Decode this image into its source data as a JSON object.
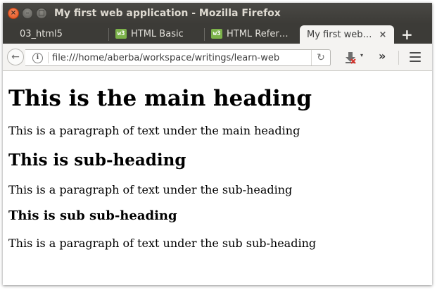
{
  "window": {
    "title": "My first web application - Mozilla Firefox",
    "close_glyph": "×",
    "minimize_glyph": "–",
    "maximize_glyph": "□"
  },
  "tabs": [
    {
      "label": "03_html5",
      "has_favicon": false,
      "active": false
    },
    {
      "label": "HTML Basic",
      "has_favicon": true,
      "active": false
    },
    {
      "label": "HTML Refer…",
      "has_favicon": true,
      "active": false
    },
    {
      "label": "My first web…",
      "has_favicon": false,
      "active": true
    }
  ],
  "tab_close_glyph": "×",
  "new_tab_glyph": "+",
  "favicon_glyph": "w3",
  "navbar": {
    "back_glyph": "←",
    "url": "file:///home/aberba/workspace/writings/learn-web",
    "info_glyph": "i",
    "reload_glyph": "↻",
    "dropdown_glyph": "▾",
    "overflow_glyph": "»"
  },
  "page": {
    "h1": "This is the main heading",
    "p1": "This is a paragraph of text under the main heading",
    "h2": "This is sub-heading",
    "p2": "This is a paragraph of text under the sub-heading",
    "h3": "This is sub sub-heading",
    "p3": "This is a paragraph of text under the sub sub-heading"
  },
  "colors": {
    "titlebar": "#3c3b37",
    "close_button": "#e2511e",
    "favicon": "#7cb24a",
    "active_tab": "#f4f3f1"
  },
  "icons": {
    "close": "close-icon",
    "minimize": "minimize-icon",
    "maximize": "maximize-icon",
    "back": "back-arrow-icon",
    "info": "info-icon",
    "reload": "reload-icon",
    "download": "download-icon",
    "overflow": "chevron-double-right-icon",
    "menu": "hamburger-menu-icon",
    "new_tab": "plus-icon"
  }
}
